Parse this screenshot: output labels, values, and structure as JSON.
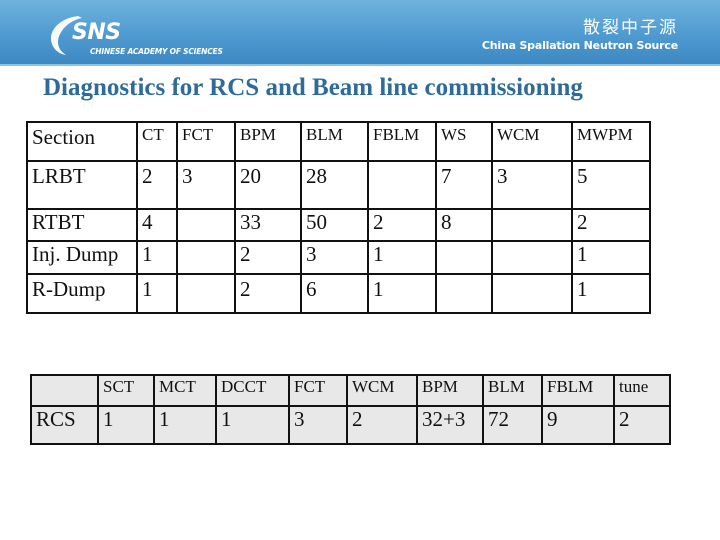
{
  "header": {
    "logo_text": "SNS",
    "logo_subtext": "CHINESE ACADEMY OF SCIENCES",
    "brand_cn": "散裂中子源",
    "brand_en": "China Spallation Neutron Source",
    "banner_color": "#4f9ad0"
  },
  "title": "Diagnostics for RCS and Beam line commissioning",
  "beamline_table": {
    "columns": [
      "Section",
      "CT",
      "FCT",
      "BPM",
      "BLM",
      "FBLM",
      "WS",
      "WCM",
      "MWPM"
    ],
    "rows": [
      [
        "LRBT",
        "2",
        "3",
        "20",
        "28",
        "",
        "7",
        "3",
        "5"
      ],
      [
        "RTBT",
        "4",
        "",
        "33",
        "50",
        "2",
        "8",
        "",
        "2"
      ],
      [
        "Inj. Dump",
        "1",
        "",
        "2",
        "3",
        "1",
        "",
        "",
        "1"
      ],
      [
        "R-Dump",
        "1",
        "",
        "2",
        "6",
        "1",
        "",
        "",
        "1"
      ]
    ]
  },
  "rcs_table": {
    "columns": [
      "",
      "SCT",
      "MCT",
      "DCCT",
      "FCT",
      "WCM",
      "BPM",
      "BLM",
      "FBLM",
      "tune"
    ],
    "rows": [
      [
        "RCS",
        "1",
        "1",
        "1",
        "3",
        "2",
        "32+3",
        "72",
        "9",
        "2"
      ]
    ]
  },
  "colors": {
    "title": "#2e6b9a",
    "rcs_table_bg": "#e8e8e8"
  }
}
